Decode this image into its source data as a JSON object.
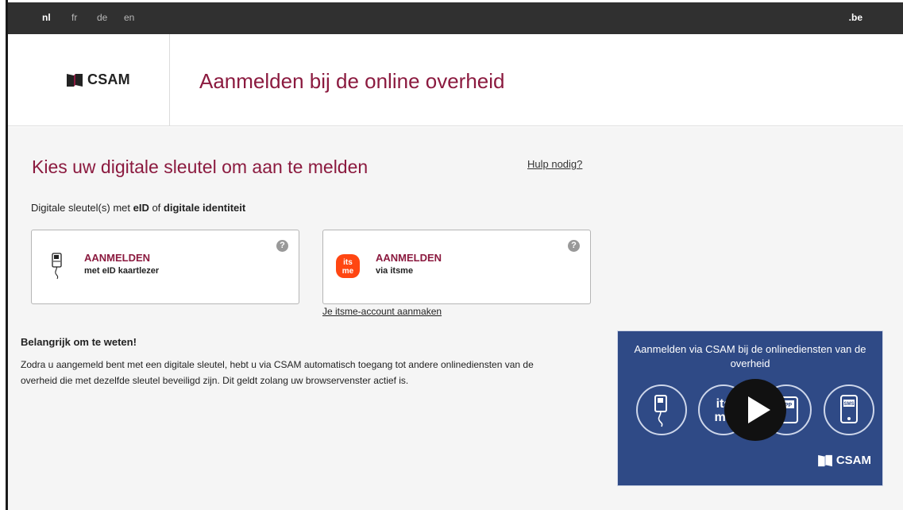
{
  "languages": [
    {
      "code": "nl",
      "active": true
    },
    {
      "code": "fr",
      "active": false
    },
    {
      "code": "de",
      "active": false
    },
    {
      "code": "en",
      "active": false
    }
  ],
  "topbar": {
    "be_label": ".be"
  },
  "header": {
    "logo_text": "CSAM",
    "title": "Aanmelden bij de online overheid"
  },
  "main": {
    "subtitle": "Kies uw digitale sleutel om aan te melden",
    "help_link": "Hulp nodig?",
    "key_label": {
      "prefix": "Digitale sleutel(s) met ",
      "bold1": "eID",
      "middle": " of ",
      "bold2": "digitale identiteit"
    }
  },
  "cards": [
    {
      "title": "AANMELDEN",
      "subtitle": "met eID kaartlezer",
      "icon": "eid-card-reader-icon",
      "help_icon": "question-icon"
    },
    {
      "title": "AANMELDEN",
      "subtitle": "via itsme",
      "icon": "itsme-icon",
      "icon_text_1": "its",
      "icon_text_2": "me",
      "help_icon": "question-icon"
    }
  ],
  "itsme_link": "Je itsme-account aanmaken",
  "info": {
    "title": "Belangrijk om te weten!",
    "text": "Zodra u aangemeld bent met een digitale sleutel, hebt u via CSAM automatisch toegang tot andere onlinediensten van de overheid die met dezelfde sleutel beveiligd zijn. Dit geldt zolang uw browservenster actief is."
  },
  "video": {
    "title": "Aanmelden via CSAM bij de onlinediensten van de overheid",
    "logo_text": "CSAM",
    "icons": [
      "eid-reader-icon",
      "itsme-icon",
      "app-icon",
      "sms-icon"
    ],
    "icon_labels": {
      "itsme_1": "its",
      "itsme_2": "me",
      "app": "APP",
      "sms": "SMS"
    }
  },
  "colors": {
    "brand": "#8b1a3f",
    "topbar": "#303030",
    "video_bg": "#2f4a86",
    "itsme": "#ff4612"
  }
}
